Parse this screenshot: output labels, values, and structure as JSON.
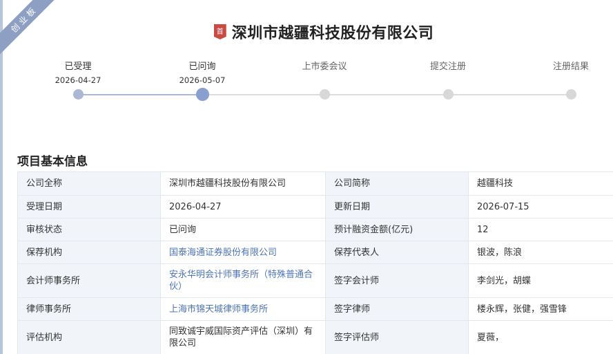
{
  "ribbon": {
    "text": "创业板"
  },
  "header": {
    "badge_text": "首",
    "company_name": "深圳市越疆科技股份有限公司"
  },
  "timeline": {
    "steps": [
      {
        "label": "已受理",
        "date": "2026-04-27",
        "status": "done"
      },
      {
        "label": "已问询",
        "date": "2026-05-07",
        "status": "current"
      },
      {
        "label": "上市委会议",
        "date": "",
        "status": "pending"
      },
      {
        "label": "提交注册",
        "date": "",
        "status": "pending"
      },
      {
        "label": "注册结果",
        "date": "",
        "status": "pending"
      }
    ]
  },
  "section": {
    "title": "项目基本信息"
  },
  "info": {
    "rows": [
      {
        "l1": "公司全称",
        "v1": "深圳市越疆科技股份有限公司",
        "l2": "公司简称",
        "v2": "越疆科技"
      },
      {
        "l1": "受理日期",
        "v1": "2026-04-27",
        "l2": "更新日期",
        "v2": "2026-07-15"
      },
      {
        "l1": "审核状态",
        "v1": "已问询",
        "l2": "预计融资金额(亿元)",
        "v2": "12"
      },
      {
        "l1": "保荐机构",
        "v1": "国泰海通证券股份有限公司",
        "l2": "保荐代表人",
        "v2": "银波，陈浪"
      },
      {
        "l1": "会计师事务所",
        "v1": "安永华明会计师事务所（特殊普通合伙）",
        "l2": "签字会计师",
        "v2": "李剑光，胡蝶"
      },
      {
        "l1": "律师事务所",
        "v1": "上海市锦天城律师事务所",
        "l2": "签字律师",
        "v2": "楼永辉，张健，强雪锋"
      },
      {
        "l1": "评估机构",
        "v1": "同致诚宇威国际资产评估（深圳）有限公司",
        "l2": "签字评估师",
        "v2": "夏薇，"
      }
    ]
  },
  "colors": {
    "accent": "#8a9fd0",
    "link": "#4d74b8",
    "label_bg": "#f1f4f8",
    "badge": "#c94a43",
    "ribbon": "#8da0c4"
  }
}
